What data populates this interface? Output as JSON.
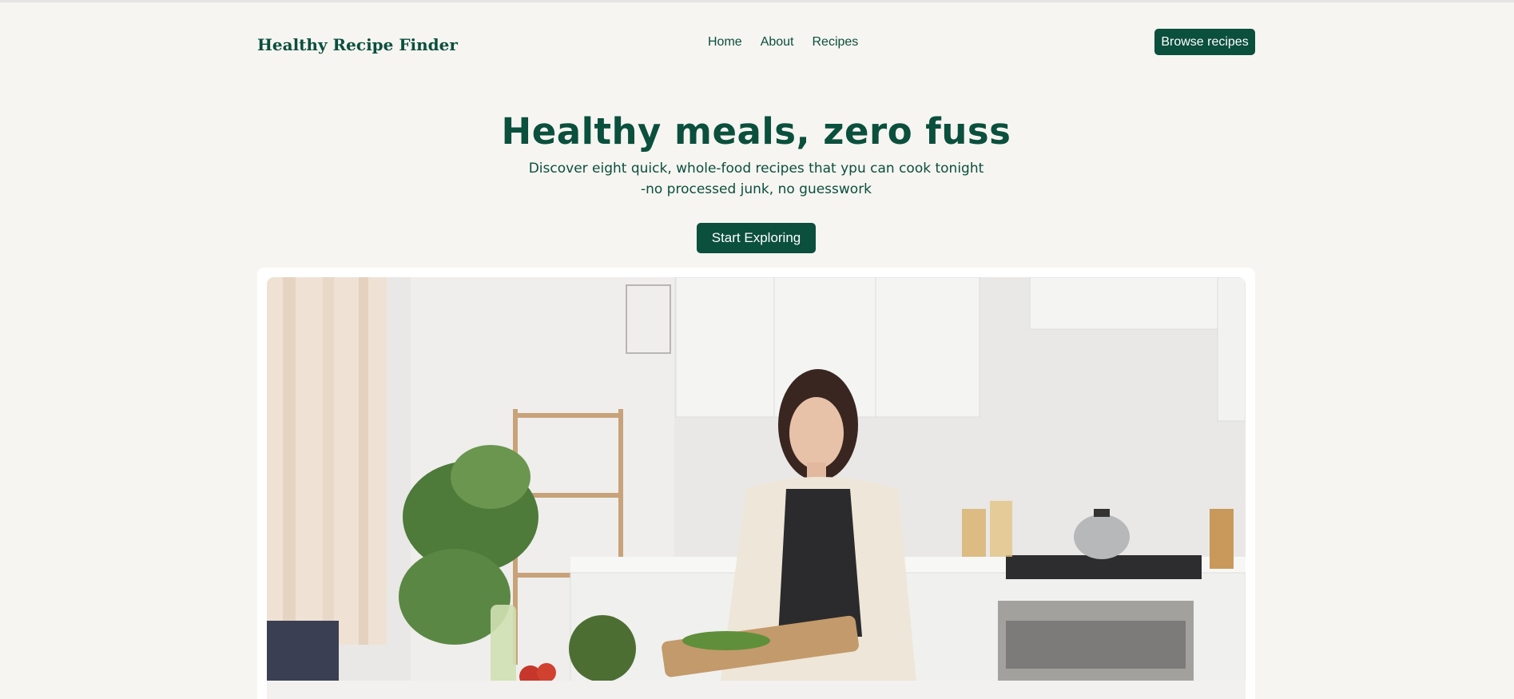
{
  "brand": {
    "name": "Healthy Recipe Finder"
  },
  "nav": {
    "items": [
      {
        "label": "Home"
      },
      {
        "label": "About"
      },
      {
        "label": "Recipes"
      }
    ],
    "cta_label": "Browse recipes"
  },
  "hero": {
    "title": "Healthy meals, zero fuss",
    "subtitle_line1": "Discover eight quick, whole-food recipes that ypu can cook tonight",
    "subtitle_line2": "-no processed junk, no guesswork",
    "cta_label": "Start Exploring"
  },
  "image": {
    "subject": "woman-slicing-cucumber-in-kitchen"
  },
  "colors": {
    "brand_green": "#0b4f3d",
    "page_bg": "#f6f5f1"
  }
}
